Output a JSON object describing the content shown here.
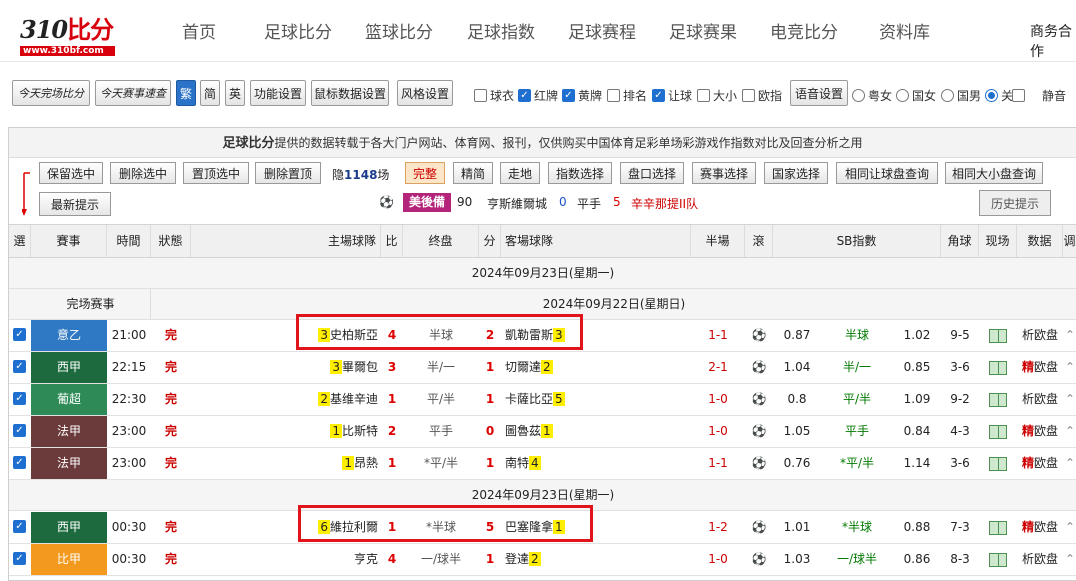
{
  "logo": {
    "prefix": "31",
    "mark": "0",
    "cn": "比分",
    "url": "www.310bf.com"
  },
  "nav": [
    "首页",
    "足球比分",
    "篮球比分",
    "足球指数",
    "足球赛程",
    "足球赛果",
    "电竞比分",
    "资料库",
    "商务合作"
  ],
  "toolbar": {
    "buttons": [
      "今天完场比分",
      "今天赛事速查",
      "繁",
      "简",
      "英",
      "功能设置",
      "鼠标数据设置",
      "风格设置",
      "语音设置"
    ],
    "checks": [
      {
        "label": "球衣",
        "checked": false
      },
      {
        "label": "红牌",
        "checked": true
      },
      {
        "label": "黄牌",
        "checked": true
      },
      {
        "label": "排名",
        "checked": false
      },
      {
        "label": "让球",
        "checked": true
      },
      {
        "label": "大小",
        "checked": false
      },
      {
        "label": "欧指",
        "checked": false
      }
    ],
    "radios": [
      {
        "label": "粤女",
        "checked": false
      },
      {
        "label": "国女",
        "checked": false
      },
      {
        "label": "国男",
        "checked": false
      },
      {
        "label": "关",
        "checked": true
      }
    ],
    "mute": "静音"
  },
  "notice": {
    "bold": "足球比分",
    "text": "提供的数据转载于各大门户网站、体育网、报刊，仅供购买中国体育足彩单场彩游戏作指数对比及回查分析之用"
  },
  "controls": {
    "keep": "保留选中",
    "remove": "删除选中",
    "pin": "置顶选中",
    "unpin": "删除置顶",
    "hidden_prefix": "隐",
    "hidden_count": "1148",
    "hidden_suffix": "场",
    "full": "完整",
    "lite": "精简",
    "walk": "走地",
    "odds_sel": "指数选择",
    "line_sel": "盘口选择",
    "match_sel": "赛事选择",
    "country_sel": "国家选择",
    "same_hcp": "相同让球盘查询",
    "same_ou": "相同大小盘查询",
    "latest": "最新提示",
    "history": "历史提示"
  },
  "tip": {
    "team": "美後備",
    "minute": "90",
    "home": "亨斯維爾城",
    "hs": "0",
    "mid": "平手",
    "as": "5",
    "away": "辛辛那提II队"
  },
  "headers": [
    "選",
    "賽事",
    "時間",
    "狀態",
    "主場球隊",
    "比",
    "终盘",
    "分",
    "客場球隊",
    "半場",
    "滾",
    "SB指數",
    "角球",
    "现场",
    "数据",
    "调"
  ],
  "date_top": "2024年09月23日(星期一)",
  "section": {
    "label": "完场赛事",
    "date": "2024年09月22日(星期日)"
  },
  "date_mid": "2024年09月23日(星期一)",
  "matches": [
    {
      "league": "意乙",
      "color": "#2f78c4",
      "time": "21:00",
      "status": "完",
      "hrank": "3",
      "home": "史柏斯亞",
      "hs": "4",
      "line": "半球",
      "as": "2",
      "away": "凱勒雷斯",
      "arank": "3",
      "half": "1-1",
      "o1": "0.87",
      "o2": "半球",
      "o3": "1.02",
      "corner": "9-5",
      "hot": "",
      "d2": "析欧盘"
    },
    {
      "league": "西甲",
      "color": "#1d6a3f",
      "time": "22:15",
      "status": "完",
      "hrank": "3",
      "home": "畢爾包",
      "hs": "3",
      "line": "半/一",
      "as": "1",
      "away": "切爾達",
      "arank": "2",
      "half": "2-1",
      "o1": "1.04",
      "o2": "半/一",
      "o3": "0.85",
      "corner": "3-6",
      "hot": "精",
      "d2": "欧盘"
    },
    {
      "league": "葡超",
      "color": "#2e8b57",
      "time": "22:30",
      "status": "完",
      "hrank": "2",
      "home": "基维辛迪",
      "hs": "1",
      "line": "平/半",
      "as": "1",
      "away": "卡薩比亞",
      "arank": "5",
      "half": "1-0",
      "o1": "0.8",
      "o2": "平/半",
      "o3": "1.09",
      "corner": "9-2",
      "hot": "",
      "d2": "析欧盘"
    },
    {
      "league": "法甲",
      "color": "#6b3a3a",
      "time": "23:00",
      "status": "完",
      "hrank": "1",
      "home": "比斯特",
      "hs": "2",
      "line": "平手",
      "as": "0",
      "away": "圖魯茲",
      "arank": "1",
      "half": "1-0",
      "o1": "1.05",
      "o2": "平手",
      "o3": "0.84",
      "corner": "4-3",
      "hot": "精",
      "d2": "欧盘"
    },
    {
      "league": "法甲",
      "color": "#6b3a3a",
      "time": "23:00",
      "status": "完",
      "hrank": "1",
      "home": "昂熱",
      "hs": "1",
      "line": "*平/半",
      "as": "1",
      "away": "南特",
      "arank": "4",
      "half": "1-1",
      "o1": "0.76",
      "o2": "*平/半",
      "o3": "1.14",
      "corner": "3-6",
      "hot": "精",
      "d2": "欧盘"
    },
    {
      "league": "西甲",
      "color": "#1d6a3f",
      "time": "00:30",
      "status": "完",
      "hrank": "6",
      "home": "維拉利爾",
      "hs": "1",
      "line": "*半球",
      "as": "5",
      "away": "巴塞隆拿",
      "arank": "1",
      "half": "1-2",
      "o1": "1.01",
      "o2": "*半球",
      "o3": "0.88",
      "corner": "7-3",
      "hot": "精",
      "d2": "欧盘"
    },
    {
      "league": "比甲",
      "color": "#f39a1e",
      "time": "00:30",
      "status": "完",
      "hrank": "",
      "home": "亨克",
      "hs": "4",
      "line": "一/球半",
      "as": "1",
      "away": "登達",
      "arank": "2",
      "half": "1-0",
      "o1": "1.03",
      "o2": "一/球半",
      "o3": "0.86",
      "corner": "8-3",
      "hot": "",
      "d2": "析欧盘"
    }
  ]
}
